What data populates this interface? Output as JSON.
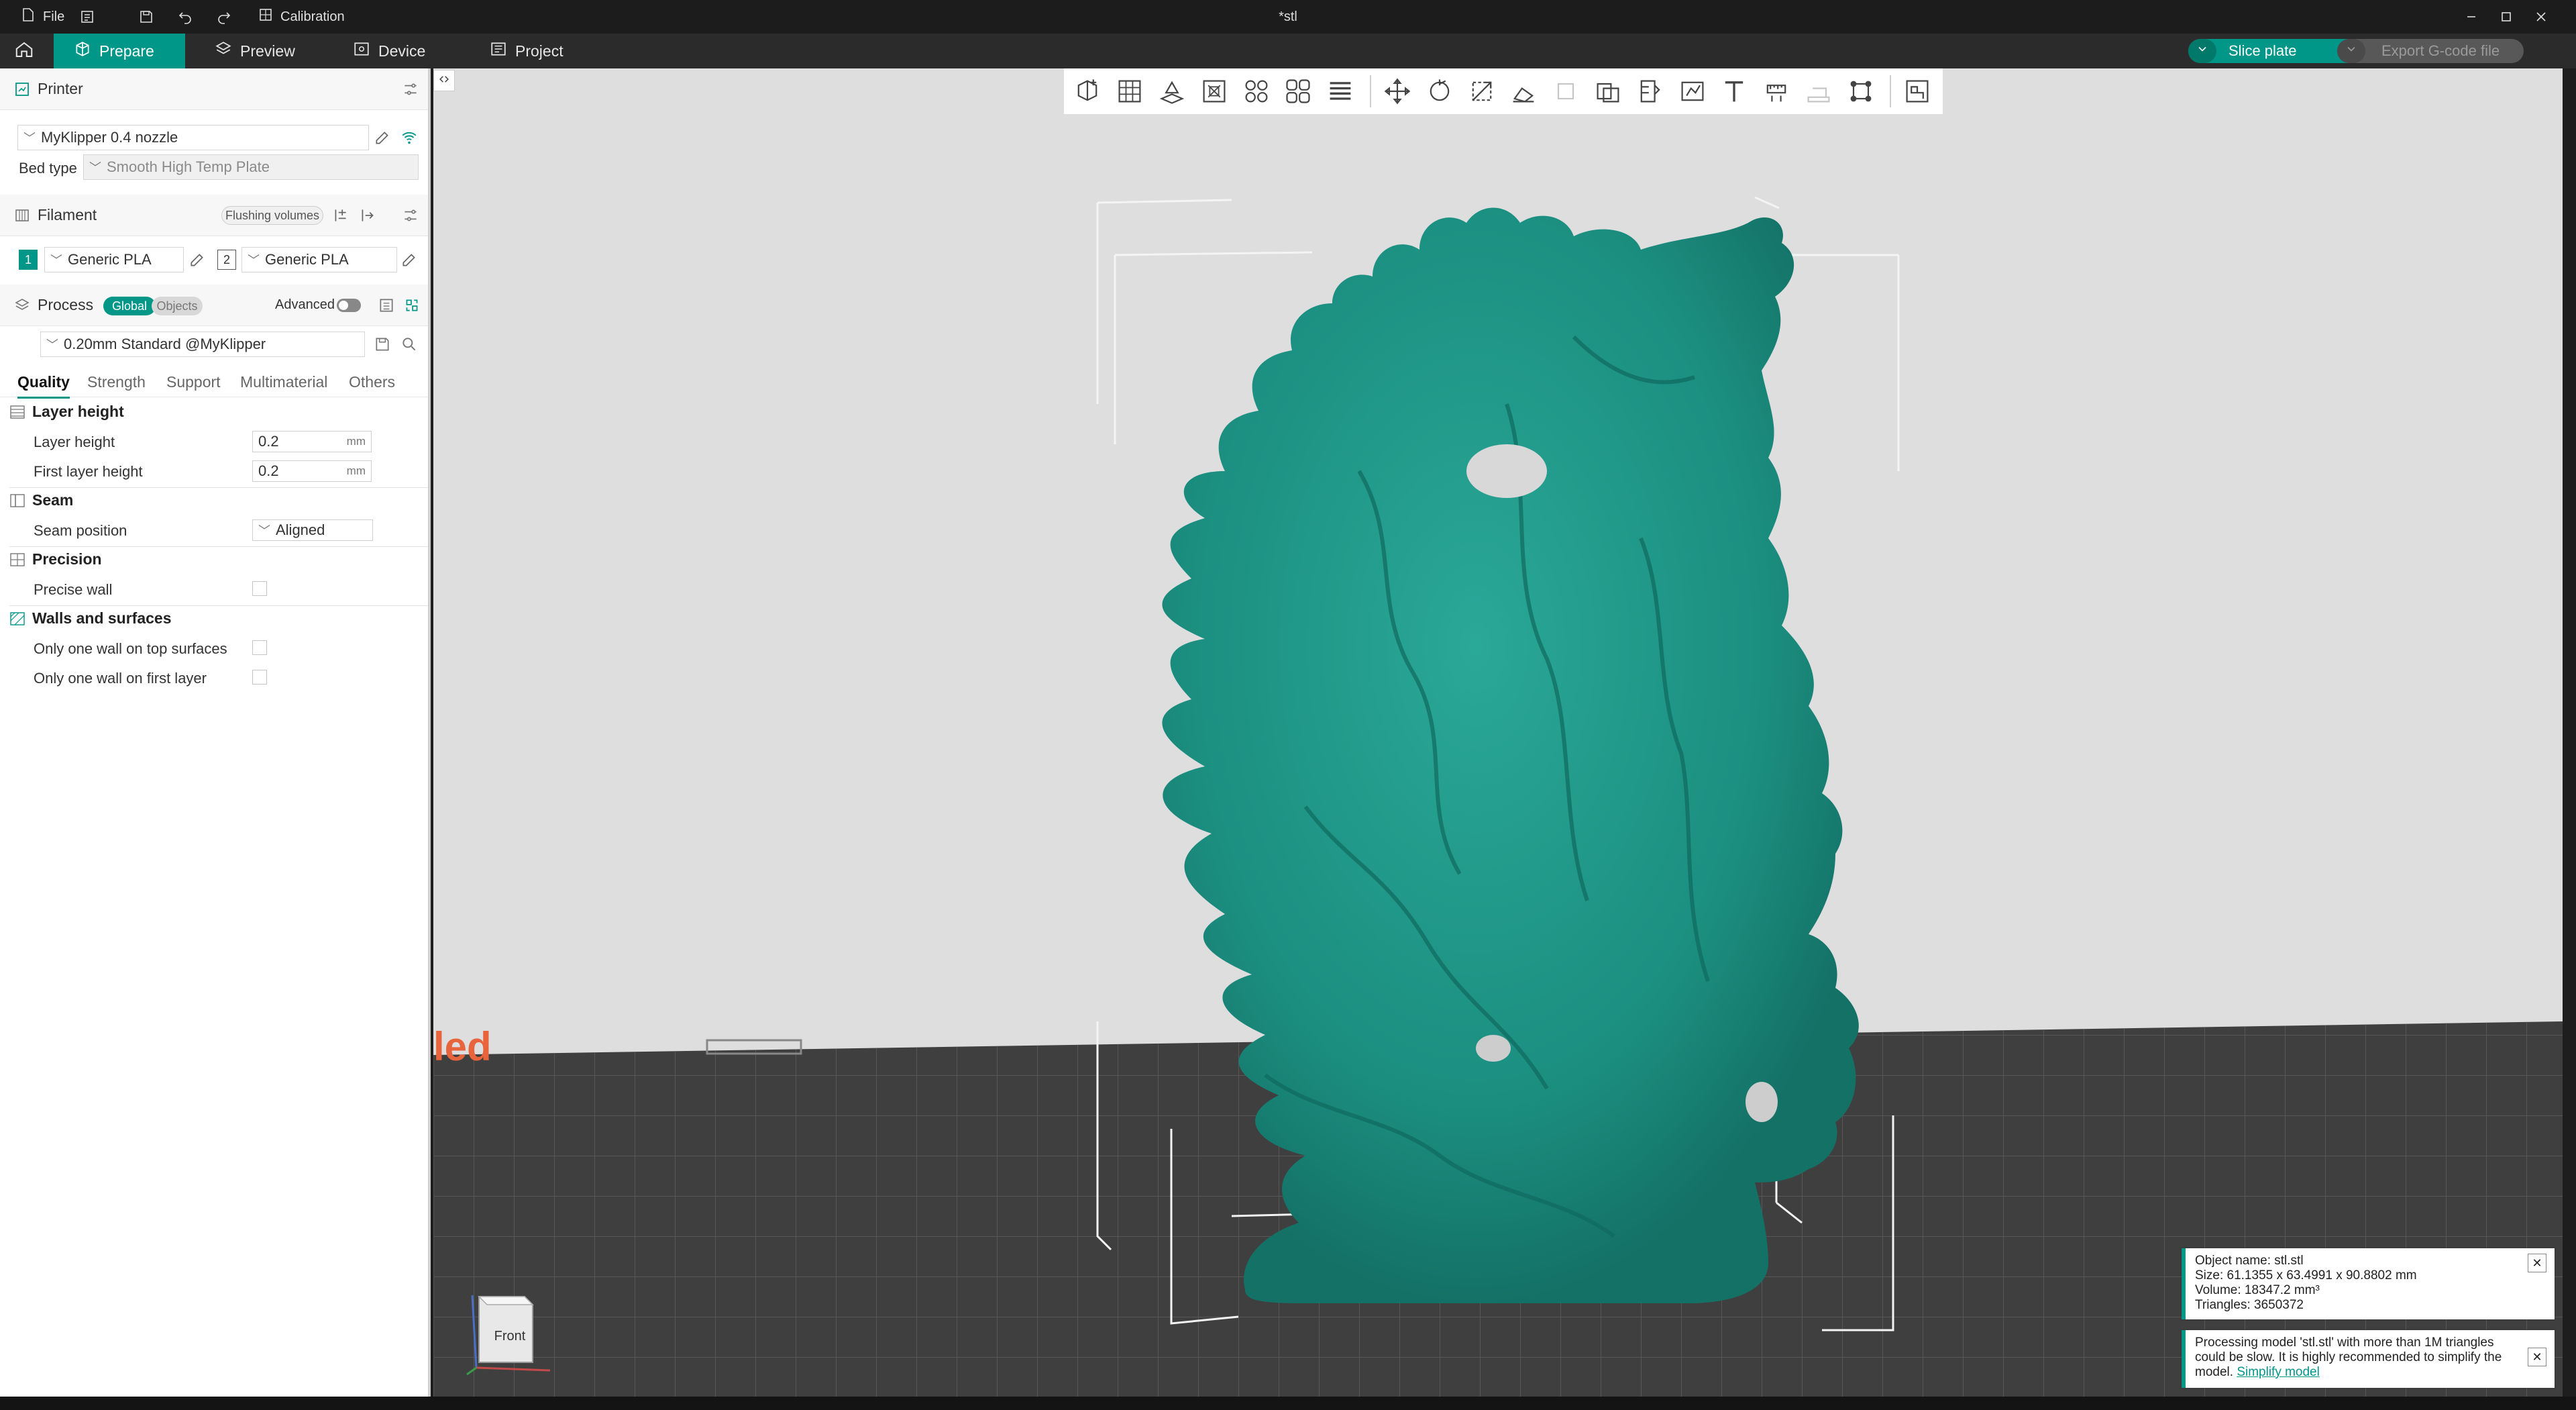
{
  "window": {
    "title": "*stl",
    "menu_file": "File",
    "calibration": "Calibration"
  },
  "nav": {
    "tabs": [
      {
        "label": "Prepare"
      },
      {
        "label": "Preview"
      },
      {
        "label": "Device"
      },
      {
        "label": "Project"
      }
    ],
    "slice_label": "Slice plate",
    "export_label": "Export G-code file"
  },
  "sidebar": {
    "printer": {
      "header": "Printer",
      "name": "MyKlipper 0.4 nozzle",
      "bed_type_label": "Bed type",
      "bed_type_value": "Smooth High Temp Plate"
    },
    "filament": {
      "header": "Filament",
      "flushing": "Flushing volumes",
      "slots": [
        {
          "index": "1",
          "name": "Generic PLA",
          "color": "#009688"
        },
        {
          "index": "2",
          "name": "Generic PLA",
          "color": "#ffffff"
        }
      ]
    },
    "process": {
      "header": "Process",
      "global": "Global",
      "objects": "Objects",
      "advanced": "Advanced",
      "profile": "0.20mm Standard @MyKlipper"
    },
    "tabs": [
      "Quality",
      "Strength",
      "Support",
      "Multimaterial",
      "Others"
    ],
    "groups": {
      "layer_height": {
        "title": "Layer height",
        "layer_height_label": "Layer height",
        "layer_height_value": "0.2",
        "first_layer_label": "First layer height",
        "first_layer_value": "0.2",
        "unit": "mm"
      },
      "seam": {
        "title": "Seam",
        "position_label": "Seam position",
        "position_value": "Aligned"
      },
      "precision": {
        "title": "Precision",
        "precise_wall": "Precise wall"
      },
      "walls": {
        "title": "Walls and surfaces",
        "one_wall_top": "Only one wall on top surfaces",
        "one_wall_first": "Only one wall on first layer"
      }
    }
  },
  "viewport": {
    "view_cube_label": "Front",
    "model_color": "#1e9385",
    "accent": "#009688"
  },
  "notifications": {
    "object_info": {
      "name": "Object name: stl.stl",
      "size": "Size: 61.1355 x 63.4991 x 90.8802 mm",
      "volume": "Volume: 18347.2 mm³",
      "triangles": "Triangles: 3650372"
    },
    "warning": {
      "text": "Processing model 'stl.stl' with more than 1M triangles could be slow. It is highly recommended to simplify the model.",
      "link": "Simplify model"
    }
  }
}
